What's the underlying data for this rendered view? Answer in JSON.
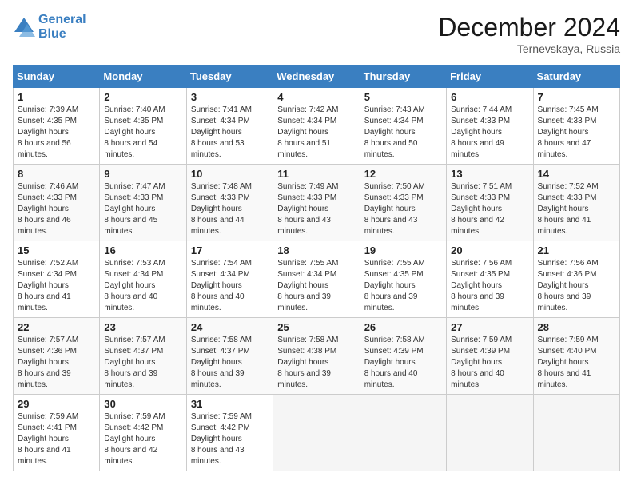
{
  "header": {
    "logo_line1": "General",
    "logo_line2": "Blue",
    "month_title": "December 2024",
    "location": "Ternevskaya, Russia"
  },
  "weekdays": [
    "Sunday",
    "Monday",
    "Tuesday",
    "Wednesday",
    "Thursday",
    "Friday",
    "Saturday"
  ],
  "weeks": [
    [
      {
        "day": "1",
        "sunrise": "7:39 AM",
        "sunset": "4:35 PM",
        "daylight": "8 hours and 56 minutes."
      },
      {
        "day": "2",
        "sunrise": "7:40 AM",
        "sunset": "4:35 PM",
        "daylight": "8 hours and 54 minutes."
      },
      {
        "day": "3",
        "sunrise": "7:41 AM",
        "sunset": "4:34 PM",
        "daylight": "8 hours and 53 minutes."
      },
      {
        "day": "4",
        "sunrise": "7:42 AM",
        "sunset": "4:34 PM",
        "daylight": "8 hours and 51 minutes."
      },
      {
        "day": "5",
        "sunrise": "7:43 AM",
        "sunset": "4:34 PM",
        "daylight": "8 hours and 50 minutes."
      },
      {
        "day": "6",
        "sunrise": "7:44 AM",
        "sunset": "4:33 PM",
        "daylight": "8 hours and 49 minutes."
      },
      {
        "day": "7",
        "sunrise": "7:45 AM",
        "sunset": "4:33 PM",
        "daylight": "8 hours and 47 minutes."
      }
    ],
    [
      {
        "day": "8",
        "sunrise": "7:46 AM",
        "sunset": "4:33 PM",
        "daylight": "8 hours and 46 minutes."
      },
      {
        "day": "9",
        "sunrise": "7:47 AM",
        "sunset": "4:33 PM",
        "daylight": "8 hours and 45 minutes."
      },
      {
        "day": "10",
        "sunrise": "7:48 AM",
        "sunset": "4:33 PM",
        "daylight": "8 hours and 44 minutes."
      },
      {
        "day": "11",
        "sunrise": "7:49 AM",
        "sunset": "4:33 PM",
        "daylight": "8 hours and 43 minutes."
      },
      {
        "day": "12",
        "sunrise": "7:50 AM",
        "sunset": "4:33 PM",
        "daylight": "8 hours and 43 minutes."
      },
      {
        "day": "13",
        "sunrise": "7:51 AM",
        "sunset": "4:33 PM",
        "daylight": "8 hours and 42 minutes."
      },
      {
        "day": "14",
        "sunrise": "7:52 AM",
        "sunset": "4:33 PM",
        "daylight": "8 hours and 41 minutes."
      }
    ],
    [
      {
        "day": "15",
        "sunrise": "7:52 AM",
        "sunset": "4:34 PM",
        "daylight": "8 hours and 41 minutes."
      },
      {
        "day": "16",
        "sunrise": "7:53 AM",
        "sunset": "4:34 PM",
        "daylight": "8 hours and 40 minutes."
      },
      {
        "day": "17",
        "sunrise": "7:54 AM",
        "sunset": "4:34 PM",
        "daylight": "8 hours and 40 minutes."
      },
      {
        "day": "18",
        "sunrise": "7:55 AM",
        "sunset": "4:34 PM",
        "daylight": "8 hours and 39 minutes."
      },
      {
        "day": "19",
        "sunrise": "7:55 AM",
        "sunset": "4:35 PM",
        "daylight": "8 hours and 39 minutes."
      },
      {
        "day": "20",
        "sunrise": "7:56 AM",
        "sunset": "4:35 PM",
        "daylight": "8 hours and 39 minutes."
      },
      {
        "day": "21",
        "sunrise": "7:56 AM",
        "sunset": "4:36 PM",
        "daylight": "8 hours and 39 minutes."
      }
    ],
    [
      {
        "day": "22",
        "sunrise": "7:57 AM",
        "sunset": "4:36 PM",
        "daylight": "8 hours and 39 minutes."
      },
      {
        "day": "23",
        "sunrise": "7:57 AM",
        "sunset": "4:37 PM",
        "daylight": "8 hours and 39 minutes."
      },
      {
        "day": "24",
        "sunrise": "7:58 AM",
        "sunset": "4:37 PM",
        "daylight": "8 hours and 39 minutes."
      },
      {
        "day": "25",
        "sunrise": "7:58 AM",
        "sunset": "4:38 PM",
        "daylight": "8 hours and 39 minutes."
      },
      {
        "day": "26",
        "sunrise": "7:58 AM",
        "sunset": "4:39 PM",
        "daylight": "8 hours and 40 minutes."
      },
      {
        "day": "27",
        "sunrise": "7:59 AM",
        "sunset": "4:39 PM",
        "daylight": "8 hours and 40 minutes."
      },
      {
        "day": "28",
        "sunrise": "7:59 AM",
        "sunset": "4:40 PM",
        "daylight": "8 hours and 41 minutes."
      }
    ],
    [
      {
        "day": "29",
        "sunrise": "7:59 AM",
        "sunset": "4:41 PM",
        "daylight": "8 hours and 41 minutes."
      },
      {
        "day": "30",
        "sunrise": "7:59 AM",
        "sunset": "4:42 PM",
        "daylight": "8 hours and 42 minutes."
      },
      {
        "day": "31",
        "sunrise": "7:59 AM",
        "sunset": "4:42 PM",
        "daylight": "8 hours and 43 minutes."
      },
      null,
      null,
      null,
      null
    ]
  ],
  "labels": {
    "sunrise": "Sunrise:",
    "sunset": "Sunset:",
    "daylight": "Daylight hours"
  }
}
